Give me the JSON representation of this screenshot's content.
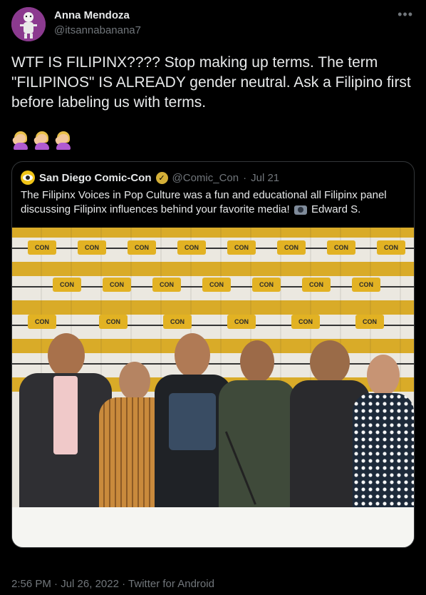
{
  "author": {
    "name": "Anna Mendoza",
    "handle": "@itsannabanana7",
    "avatar_icon": "cartoon-avatar-icon"
  },
  "more_icon": "more-options-icon",
  "tweet": {
    "text": "WTF IS FILIPINX???? Stop making up terms. The term \"FILIPINOS\" IS ALREADY gender neutral. Ask a Filipino first before labeling us with terms.",
    "emojis": [
      "woman-facepalming-icon",
      "woman-facepalming-icon",
      "woman-facepalming-icon"
    ]
  },
  "quote": {
    "name": "San Diego Comic-Con",
    "handle": "@Comic_Con",
    "separator": "·",
    "date": "Jul 21",
    "text_before": "The Filipinx Voices in Pop Culture was a fun and educational all Filipinx panel discussing Filipinx influences behind your favorite media!",
    "text_after": "Edward S.",
    "photo_icon": "camera-icon",
    "verified_icon": "verified-badge-icon"
  },
  "meta": {
    "time": "2:56 PM",
    "date": "Jul 26, 2022",
    "source": "Twitter for Android",
    "separator": "·"
  },
  "colors": {
    "background": "#000000",
    "text": "#e7e9ea",
    "muted": "#71767b",
    "border": "#333639",
    "badge": "#d4af37"
  }
}
